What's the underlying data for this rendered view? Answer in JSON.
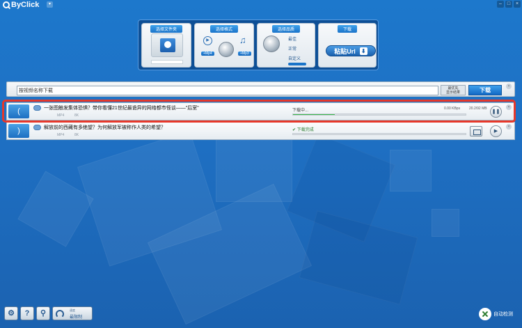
{
  "app": {
    "name": "ByClick",
    "window_buttons": [
      "–",
      "□",
      "×"
    ]
  },
  "wizard": {
    "step1": {
      "title": "选择文件夹"
    },
    "step2": {
      "title": "选择格式",
      "tag_video": "+Mp4",
      "tag_audio": "+Mp3"
    },
    "step3": {
      "title": "选择品质",
      "options": [
        "最佳",
        "正常",
        "自定义"
      ]
    },
    "step4": {
      "title": "下载",
      "paste_label": "粘贴Url",
      "arrow": "⬇"
    }
  },
  "search": {
    "value": "按视频名称下载",
    "open_label_1": "最优先",
    "open_label_2": "显示结果",
    "download_label": "下载",
    "close": "×"
  },
  "tasks": [
    {
      "title": "一张图触发集体恐惧？带你看懂21世纪最诡异的网络都市怪谈——\"后室\"",
      "format": "MP4",
      "quality": "8K",
      "status": "下载中...",
      "progress": 0.24,
      "speed": "0.00 KBps",
      "size": "20.2/92 MB",
      "action": "❚❚",
      "close": "×",
      "thumb_glyph": "("
    },
    {
      "title": "解放前的西藏有多绝望？为何解放军被称作人类的希望？",
      "format": "MP4",
      "quality": "8K",
      "status": "下载完成",
      "progress": 1.0,
      "action": "▶",
      "close": "×",
      "thumb_glyph": ")"
    }
  ],
  "toolbar": {
    "settings_icon": "⚙",
    "help_icon": "?",
    "search_icon": "⚲",
    "speed_label_small": "速度",
    "speed_label": "最限制"
  },
  "auto_detect": {
    "label": "自动检测"
  },
  "colors": {
    "accent": "#1a74c9",
    "highlight": "#e6382b",
    "progress": "#1e9c30"
  }
}
